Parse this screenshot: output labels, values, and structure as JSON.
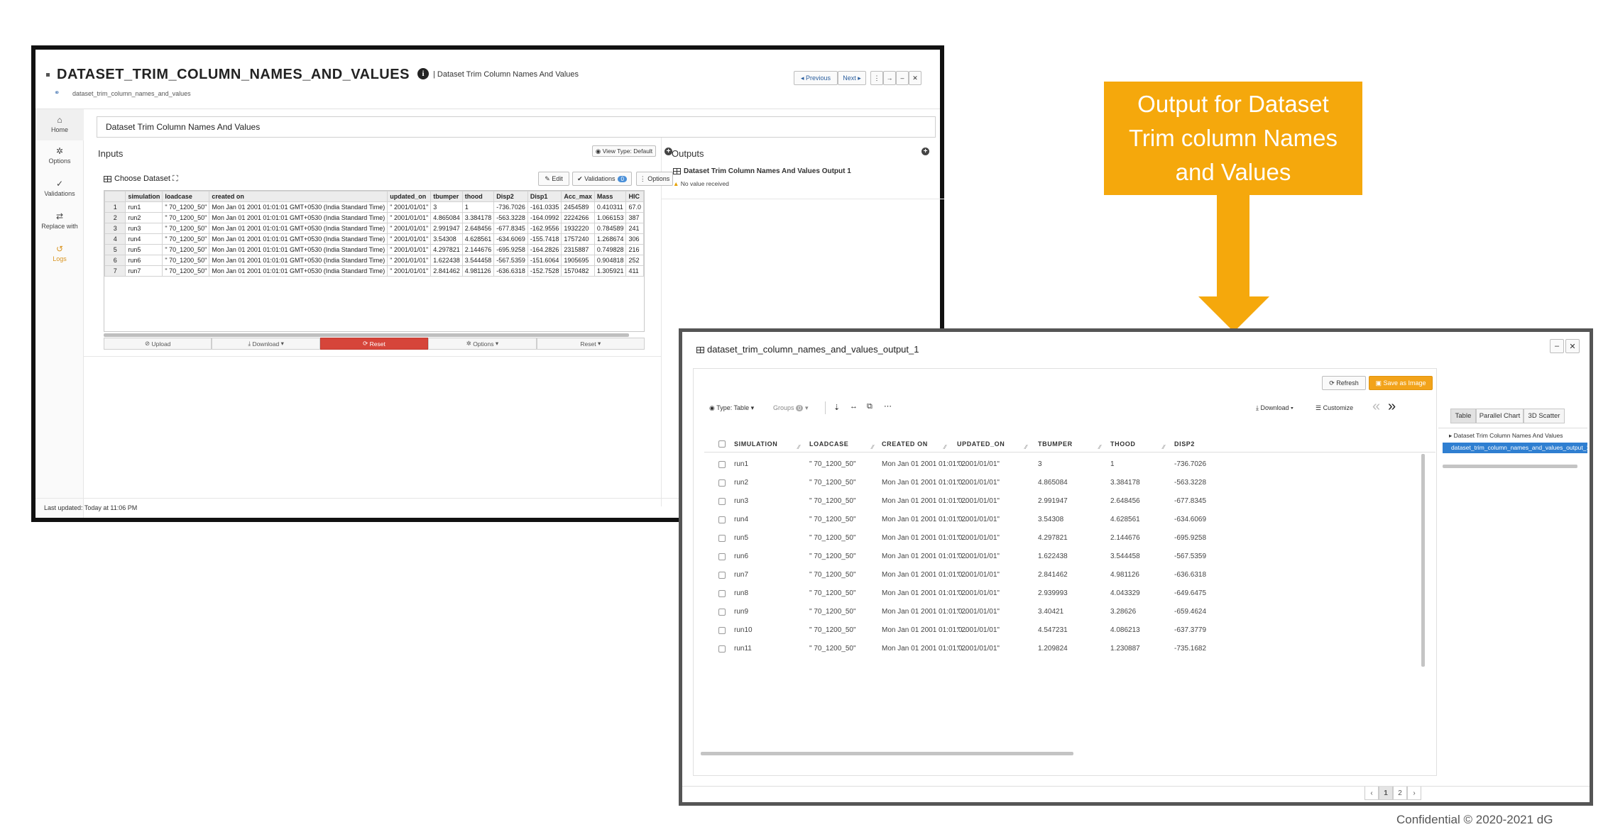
{
  "win1": {
    "title": "DATASET_TRIM_COLUMN_NAMES_AND_VALUES",
    "subtitle": "| Dataset Trim Column Names And Values",
    "slug": "dataset_trim_column_names_and_values",
    "nav": {
      "previous": "Previous",
      "next": "Next"
    },
    "sidebar": [
      {
        "label": "Home",
        "icon": "home-icon"
      },
      {
        "label": "Options",
        "icon": "gear-icon"
      },
      {
        "label": "Validations",
        "icon": "check-icon"
      },
      {
        "label": "Replace with",
        "icon": "swap-icon"
      },
      {
        "label": "Logs",
        "icon": "history-icon"
      }
    ],
    "page_name": "Dataset Trim Column Names And Values",
    "inputs_label": "Inputs",
    "view_type": "View Type: Default",
    "choose_dataset": "Choose Dataset",
    "edit": "Edit",
    "validations": "Validations",
    "validations_count": "0",
    "options": "Options",
    "table": {
      "columns": [
        "simulation",
        "loadcase",
        "created on",
        "updated_on",
        "tbumper",
        "thood",
        "Disp2",
        "Disp1",
        "Acc_max",
        "Mass",
        "HIC"
      ],
      "rows": [
        [
          "1",
          "run1",
          "\" 70_1200_50\"",
          "Mon Jan 01 2001 01:01:01 GMT+0530 (India Standard Time)",
          "\" 2001/01/01\"",
          "3",
          "1",
          "-736.7026",
          "-161.0335",
          "2454589",
          "0.410311",
          "67.0"
        ],
        [
          "2",
          "run2",
          "\" 70_1200_50\"",
          "Mon Jan 01 2001 01:01:01 GMT+0530 (India Standard Time)",
          "\" 2001/01/01\"",
          "4.865084",
          "3.384178",
          "-563.3228",
          "-164.0992",
          "2224266",
          "1.066153",
          "387"
        ],
        [
          "3",
          "run3",
          "\" 70_1200_50\"",
          "Mon Jan 01 2001 01:01:01 GMT+0530 (India Standard Time)",
          "\" 2001/01/01\"",
          "2.991947",
          "2.648456",
          "-677.8345",
          "-162.9556",
          "1932220",
          "0.784589",
          "241"
        ],
        [
          "4",
          "run4",
          "\" 70_1200_50\"",
          "Mon Jan 01 2001 01:01:01 GMT+0530 (India Standard Time)",
          "\" 2001/01/01\"",
          "3.54308",
          "4.628561",
          "-634.6069",
          "-155.7418",
          "1757240",
          "1.268674",
          "306"
        ],
        [
          "5",
          "run5",
          "\" 70_1200_50\"",
          "Mon Jan 01 2001 01:01:01 GMT+0530 (India Standard Time)",
          "\" 2001/01/01\"",
          "4.297821",
          "2.144676",
          "-695.9258",
          "-164.2826",
          "2315887",
          "0.749828",
          "216"
        ],
        [
          "6",
          "run6",
          "\" 70_1200_50\"",
          "Mon Jan 01 2001 01:01:01 GMT+0530 (India Standard Time)",
          "\" 2001/01/01\"",
          "1.622438",
          "3.544458",
          "-567.5359",
          "-151.6064",
          "1905695",
          "0.904818",
          "252"
        ],
        [
          "7",
          "run7",
          "\" 70_1200_50\"",
          "Mon Jan 01 2001 01:01:01 GMT+0530 (India Standard Time)",
          "\" 2001/01/01\"",
          "2.841462",
          "4.981126",
          "-636.6318",
          "-152.7528",
          "1570482",
          "1.305921",
          "411"
        ]
      ]
    },
    "toolbar": [
      "Upload",
      "Download",
      "Reset",
      "Options",
      "Reset"
    ],
    "outputs_label": "Outputs",
    "output_name": "Dataset Trim Column Names And Values Output 1",
    "no_value": "No value received",
    "last_updated": "Last updated: Today at 11:06 PM"
  },
  "callout": {
    "line1": "Output for Dataset",
    "line2": "Trim column Names",
    "line3": "and Values",
    "color": "#f5a80c"
  },
  "win2": {
    "title": "dataset_trim_column_names_and_values_output_1",
    "refresh": "Refresh",
    "save_as_image": "Save as Image",
    "type_table": "Type: Table",
    "groups": "Groups",
    "groups_count": "0",
    "download": "Download",
    "customize": "Customize",
    "columns": [
      "SIMULATION",
      "LOADCASE",
      "CREATED ON",
      "UPDATED_ON",
      "TBUMPER",
      "THOOD",
      "DISP2"
    ],
    "rows": [
      [
        "run1",
        "\" 70_1200_50\"",
        "Mon Jan 01 2001 01:01:0...",
        "\" 2001/01/01\"",
        "3",
        "1",
        "-736.7026"
      ],
      [
        "run2",
        "\" 70_1200_50\"",
        "Mon Jan 01 2001 01:01:0...",
        "\" 2001/01/01\"",
        "4.865084",
        "3.384178",
        "-563.3228"
      ],
      [
        "run3",
        "\" 70_1200_50\"",
        "Mon Jan 01 2001 01:01:0...",
        "\" 2001/01/01\"",
        "2.991947",
        "2.648456",
        "-677.8345"
      ],
      [
        "run4",
        "\" 70_1200_50\"",
        "Mon Jan 01 2001 01:01:0...",
        "\" 2001/01/01\"",
        "3.54308",
        "4.628561",
        "-634.6069"
      ],
      [
        "run5",
        "\" 70_1200_50\"",
        "Mon Jan 01 2001 01:01:0...",
        "\" 2001/01/01\"",
        "4.297821",
        "2.144676",
        "-695.9258"
      ],
      [
        "run6",
        "\" 70_1200_50\"",
        "Mon Jan 01 2001 01:01:0...",
        "\" 2001/01/01\"",
        "1.622438",
        "3.544458",
        "-567.5359"
      ],
      [
        "run7",
        "\" 70_1200_50\"",
        "Mon Jan 01 2001 01:01:0...",
        "\" 2001/01/01\"",
        "2.841462",
        "4.981126",
        "-636.6318"
      ],
      [
        "run8",
        "\" 70_1200_50\"",
        "Mon Jan 01 2001 01:01:0...",
        "\" 2001/01/01\"",
        "2.939993",
        "4.043329",
        "-649.6475"
      ],
      [
        "run9",
        "\" 70_1200_50\"",
        "Mon Jan 01 2001 01:01:0...",
        "\" 2001/01/01\"",
        "3.40421",
        "3.28626",
        "-659.4624"
      ],
      [
        "run10",
        "\" 70_1200_50\"",
        "Mon Jan 01 2001 01:01:0...",
        "\" 2001/01/01\"",
        "4.547231",
        "4.086213",
        "-637.3779"
      ],
      [
        "run11",
        "\" 70_1200_50\"",
        "Mon Jan 01 2001 01:01:0...",
        "\" 2001/01/01\"",
        "1.209824",
        "1.230887",
        "-735.1682"
      ]
    ],
    "pages": [
      "1",
      "2"
    ],
    "tabs": [
      "Table",
      "Parallel Chart",
      "3D Scatter"
    ],
    "tree_parent": "Dataset Trim Column Names And Values",
    "tree_selected": "dataset_trim_column_names_and_values_output_1"
  },
  "copyright": "Confidential © 2020-2021 dG"
}
